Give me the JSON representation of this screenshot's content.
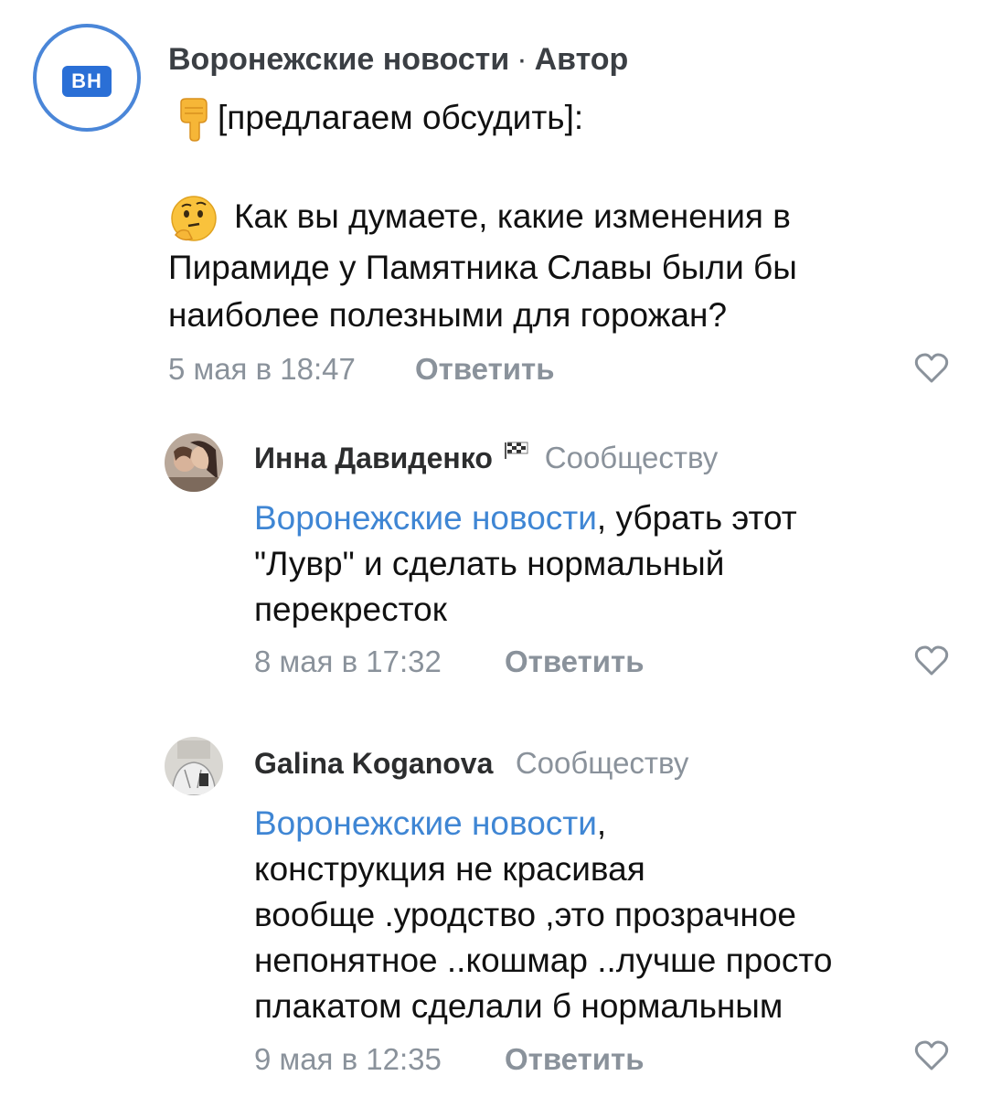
{
  "post": {
    "avatar_text": "ВН",
    "author": "Воронежские новости",
    "separator": "·",
    "author_role": "Автор",
    "line1": "[предлагаем обсудить]:",
    "line2": "Как вы думаете, какие изменения в",
    "line3": "Пирамиде у Памятника Славы были бы",
    "line4": "наиболее полезными для горожан?",
    "date": "5 мая в 18:47",
    "reply_label": "Ответить"
  },
  "replies": [
    {
      "author": "Инна Давиденко",
      "target": "Сообществу",
      "mention": "Воронежские новости",
      "lines": [
        ", убрать этот",
        "\"Лувр\" и сделать нормальный",
        "перекресток"
      ],
      "date": "8 мая в 17:32",
      "reply_label": "Ответить"
    },
    {
      "author": "Galina Koganova",
      "target": "Сообществу",
      "mention": "Воронежские новости",
      "lines": [
        ",",
        "конструкция не красивая",
        "вообще .уродство ,это прозрачное",
        "непонятное ..кошмар ..лучше просто",
        "плакатом сделали б нормальным"
      ],
      "date": "9 мая в 12:35",
      "reply_label": "Ответить"
    }
  ],
  "icons": {
    "pointing_down": "backhand-index-pointing-down-icon",
    "thinking": "thinking-face-icon",
    "checkered_flag": "checkered-flag-icon",
    "like": "heart-outline-icon"
  },
  "colors": {
    "accent": "#4a86d8",
    "mention": "#3f86d4",
    "meta": "#8a929b"
  }
}
